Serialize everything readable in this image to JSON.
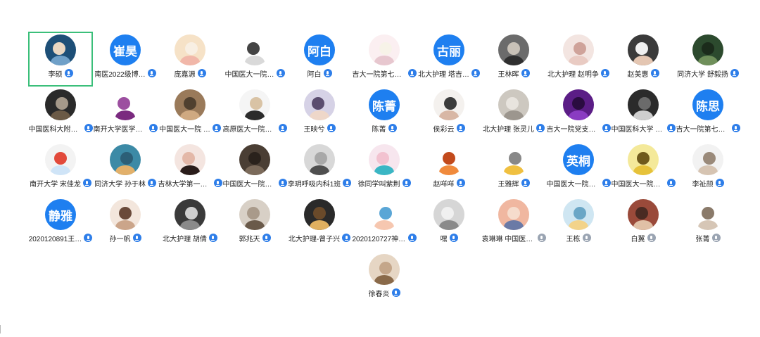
{
  "participants": [
    {
      "name": "李硕",
      "text": "",
      "colors": [
        "#1d4f77",
        "#6fa0c8",
        "#e9d7c2"
      ],
      "selected": true,
      "mic": "muted"
    },
    {
      "name": "南医2022级博…",
      "text": "崔昊",
      "colors": [
        "#1e7ff0"
      ],
      "mic": "on"
    },
    {
      "name": "庞嘉源",
      "text": "",
      "colors": [
        "#f6e2c7",
        "#f1b7a9",
        "#f8efe3"
      ],
      "mic": "on"
    },
    {
      "name": "中国医大一院…",
      "text": "",
      "colors": [
        "#ffffff",
        "#d9d9d9",
        "#444444"
      ],
      "mic": "on"
    },
    {
      "name": "阿白",
      "text": "阿白",
      "colors": [
        "#1e7ff0"
      ],
      "mic": "on"
    },
    {
      "name": "吉大一院第七党…",
      "text": "",
      "colors": [
        "#fbeff1",
        "#e7c7cf",
        "#f7f3e8"
      ],
      "mic": "on"
    },
    {
      "name": "北大护理 塔吉…",
      "text": "古丽",
      "colors": [
        "#1e7ff0"
      ],
      "mic": "on"
    },
    {
      "name": "王林晖",
      "text": "",
      "colors": [
        "#6b6b6b",
        "#2f2f2f",
        "#c9c2b8"
      ],
      "mic": "on"
    },
    {
      "name": "北大护理 赵明争",
      "text": "",
      "colors": [
        "#f3e5e1",
        "#e9cbc3",
        "#cfa39a"
      ],
      "mic": "on"
    },
    {
      "name": "赵美惠",
      "text": "",
      "colors": [
        "#3a3a3a",
        "#e4c6b2",
        "#f0f0f0"
      ],
      "mic": "on"
    },
    {
      "name": "同济大学 舒毅扬",
      "text": "",
      "colors": [
        "#2c4a2e",
        "#6f8f5a",
        "#1b2b1b"
      ],
      "mic": "on"
    },
    {
      "name": "中国医科大附一…",
      "text": "",
      "colors": [
        "#2a2a2a",
        "#6b5a46",
        "#a5998a"
      ],
      "mic": "on"
    },
    {
      "name": "南开大学医学院…",
      "text": "",
      "colors": [
        "#ffffff",
        "#7a2a7f",
        "#9c4fa0"
      ],
      "mic": "on"
    },
    {
      "name": "中国医大一院 …",
      "text": "",
      "colors": [
        "#9a7a5a",
        "#cfa981",
        "#50402f"
      ],
      "mic": "on"
    },
    {
      "name": "高原医大一院传…",
      "text": "",
      "colors": [
        "#f5f5f5",
        "#2b2b2b",
        "#d9c3a5"
      ],
      "mic": "on"
    },
    {
      "name": "王映兮",
      "text": "",
      "colors": [
        "#d6d2e6",
        "#eed7c9",
        "#5b4d6f"
      ],
      "mic": "on"
    },
    {
      "name": "陈菁",
      "text": "陈菁",
      "colors": [
        "#1e7ff0"
      ],
      "mic": "on"
    },
    {
      "name": "侯彩云",
      "text": "",
      "colors": [
        "#f4f1ee",
        "#d8b7a5",
        "#3c3c3c"
      ],
      "mic": "on"
    },
    {
      "name": "北大护理 张灵儿",
      "text": "",
      "colors": [
        "#cdc8c0",
        "#9c968e",
        "#e8e4de"
      ],
      "mic": "on"
    },
    {
      "name": "吉大一院党支部…",
      "text": "",
      "colors": [
        "#5b1d86",
        "#8a3cc2",
        "#2a0c40"
      ],
      "mic": "on"
    },
    {
      "name": "中国医科大学 张晓",
      "text": "",
      "colors": [
        "#2b2b2b",
        "#cfcfcf",
        "#6b6b6b"
      ],
      "mic": "on"
    },
    {
      "name": "吉大一院第七党…",
      "text": "陈思",
      "colors": [
        "#1e7ff0"
      ],
      "mic": "on"
    },
    {
      "name": "南开大学 宋佳龙",
      "text": "",
      "colors": [
        "#f3f3f3",
        "#cfe4f7",
        "#e24a3b"
      ],
      "mic": "on"
    },
    {
      "name": "同济大学 孙于林",
      "text": "",
      "colors": [
        "#3c8aa6",
        "#e2b06a",
        "#2c5f77"
      ],
      "mic": "on"
    },
    {
      "name": "吉林大学第一医…",
      "text": "",
      "colors": [
        "#f4e5e0",
        "#2a1d1a",
        "#e3b8a8"
      ],
      "mic": "on"
    },
    {
      "name": "中国医大一院胡明",
      "text": "",
      "colors": [
        "#4a3e34",
        "#7b6a5a",
        "#2a221c"
      ],
      "mic": "on"
    },
    {
      "name": "李玥呼吸内科1班",
      "text": "",
      "colors": [
        "#d8d8d8",
        "#4f4f4f",
        "#a8a8a8"
      ],
      "mic": "on"
    },
    {
      "name": "徐同学叫紫荆",
      "text": "",
      "colors": [
        "#f7e6ee",
        "#3ab6c4",
        "#f2c2d0"
      ],
      "mic": "on"
    },
    {
      "name": "赵咩咩",
      "text": "",
      "colors": [
        "#ffffff",
        "#f08a3c",
        "#c24a1c"
      ],
      "mic": "on"
    },
    {
      "name": "王雅辉",
      "text": "",
      "colors": [
        "#ffffff",
        "#f0c040",
        "#888888"
      ],
      "mic": "on"
    },
    {
      "name": "中国医大一院李…",
      "text": "英桐",
      "colors": [
        "#1e7ff0"
      ],
      "mic": "on"
    },
    {
      "name": "中国医大一院荷鑫",
      "text": "",
      "colors": [
        "#f4e99a",
        "#e6c23a",
        "#6f5a1c"
      ],
      "mic": "on"
    },
    {
      "name": "李祉颉",
      "text": "",
      "colors": [
        "#f2f2f2",
        "#d6c4b2",
        "#9a8a7a"
      ],
      "mic": "on"
    },
    {
      "name": "2020120891王…",
      "text": "静雅",
      "colors": [
        "#1e7ff0"
      ],
      "mic": "on"
    },
    {
      "name": "孙一帆",
      "text": "",
      "colors": [
        "#f3e6dc",
        "#cba58a",
        "#6a4a3a"
      ],
      "mic": "on"
    },
    {
      "name": "北大护理 胡倩",
      "text": "",
      "colors": [
        "#3a3a3a",
        "#8a8a8a",
        "#cfcfcf"
      ],
      "mic": "on"
    },
    {
      "name": "郭兆天",
      "text": "",
      "colors": [
        "#d8d0c6",
        "#6a5a4a",
        "#a99a8a"
      ],
      "mic": "on"
    },
    {
      "name": "北大护理-曾子兴",
      "text": "",
      "colors": [
        "#2a2a2a",
        "#e0b060",
        "#6a4a2a"
      ],
      "mic": "on"
    },
    {
      "name": "2020120727神内朱…",
      "text": "",
      "colors": [
        "#ffffff",
        "#f6c7b0",
        "#5aa6d6"
      ],
      "mic": "on"
    },
    {
      "name": "嘿",
      "text": "",
      "colors": [
        "#d6d6d6",
        "#8a8a8a",
        "#f0f0f0"
      ],
      "mic": "on"
    },
    {
      "name": "袁琳琳 中国医大一院",
      "text": "",
      "colors": [
        "#f0b7a0",
        "#6a7aa6",
        "#f6dccc"
      ],
      "mic": "off"
    },
    {
      "name": "王栋",
      "text": "",
      "colors": [
        "#cfe6f2",
        "#f2d38a",
        "#6aa6c6"
      ],
      "mic": "off"
    },
    {
      "name": "白翼",
      "text": "",
      "colors": [
        "#9a4a3a",
        "#e0c0a6",
        "#4a2a22"
      ],
      "mic": "off"
    },
    {
      "name": "张菁",
      "text": "",
      "colors": [
        "#ffffff",
        "#d6c6b6",
        "#8a7a6a"
      ],
      "mic": "off"
    },
    {
      "name": "徐春炎",
      "text": "",
      "colors": [
        "#e6d6c4",
        "#8a6a4a",
        "#c4a68a"
      ],
      "mic": "on"
    }
  ]
}
